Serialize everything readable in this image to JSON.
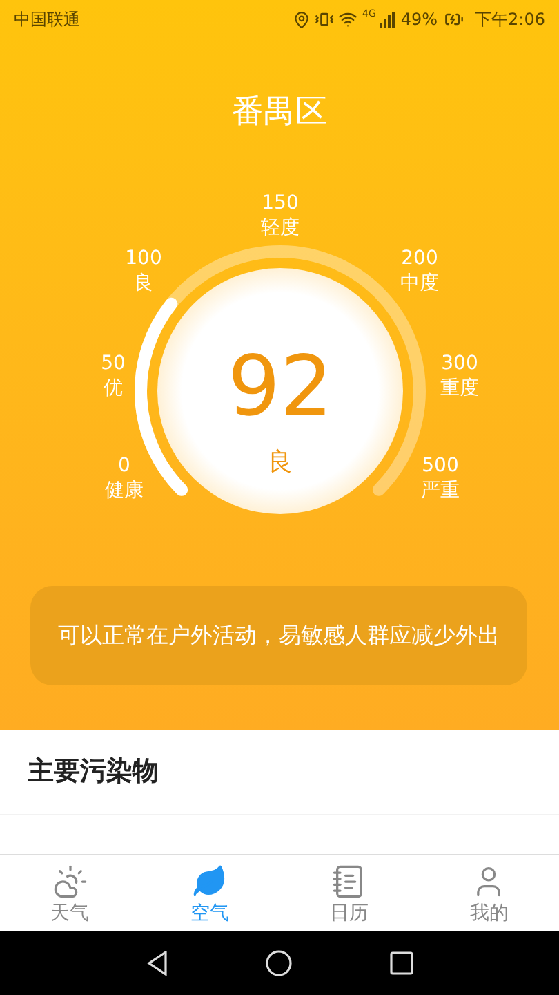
{
  "status_bar": {
    "carrier": "中国联通",
    "battery": "49%",
    "time": "下午2:06",
    "network": "4G"
  },
  "city": "番禺区",
  "gauge": {
    "value": "92",
    "grade": "良",
    "ticks": [
      {
        "value": "150",
        "label": "轻度"
      },
      {
        "value": "100",
        "label": "良"
      },
      {
        "value": "200",
        "label": "中度"
      },
      {
        "value": "50",
        "label": "优"
      },
      {
        "value": "300",
        "label": "重度"
      },
      {
        "value": "0",
        "label": "健康"
      },
      {
        "value": "500",
        "label": "严重"
      }
    ]
  },
  "advice": "可以正常在户外活动，易敏感人群应减少外出",
  "pollutants": {
    "title": "主要污染物"
  },
  "tab_bar": [
    {
      "label": "天气",
      "kind": "weather",
      "selected": false
    },
    {
      "label": "空气",
      "kind": "leaf",
      "selected": true
    },
    {
      "label": "日历",
      "kind": "calendar",
      "selected": false
    },
    {
      "label": "我的",
      "kind": "person",
      "selected": false
    }
  ]
}
